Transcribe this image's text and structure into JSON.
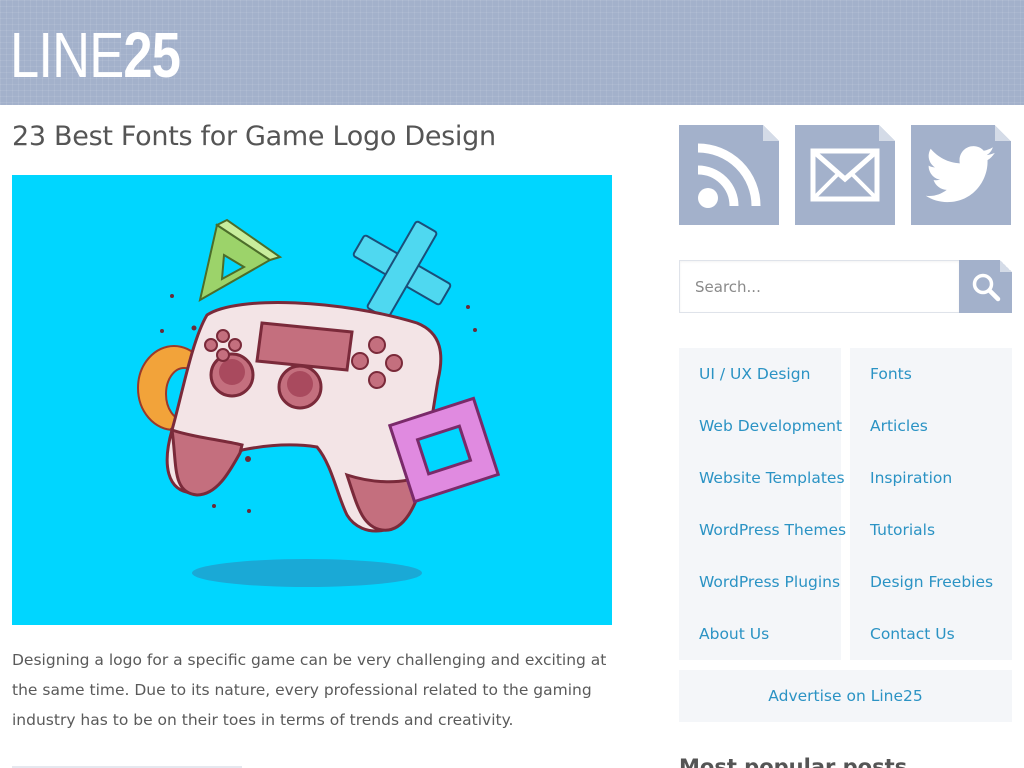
{
  "site": {
    "logo_thin": "LINE",
    "logo_bold": "25"
  },
  "post": {
    "title": "23 Best Fonts for Game Logo Design",
    "excerpt": "Designing a logo for a specific game can be very challenging and exciting at the same time. Due to its nature, every professional related to the gaming industry has to be on their toes in terms of trends and creativity."
  },
  "sidebar": {
    "social": [
      {
        "icon": "rss-icon"
      },
      {
        "icon": "mail-icon"
      },
      {
        "icon": "twitter-icon"
      }
    ],
    "search": {
      "placeholder": "Search..."
    },
    "categories_left": [
      "UI / UX Design",
      "Web Development",
      "Website Templates",
      "WordPress Themes",
      "WordPress Plugins",
      "About Us"
    ],
    "categories_right": [
      "Fonts",
      "Articles",
      "Inspiration",
      "Tutorials",
      "Design Freebies",
      "Contact Us"
    ],
    "advertise": "Advertise on Line25",
    "popular_heading": "Most popular posts"
  },
  "colors": {
    "header": "#a3b1cb",
    "hero_bg": "#00d6ff",
    "link": "#2b93c4",
    "panel": "#f4f6f9"
  }
}
